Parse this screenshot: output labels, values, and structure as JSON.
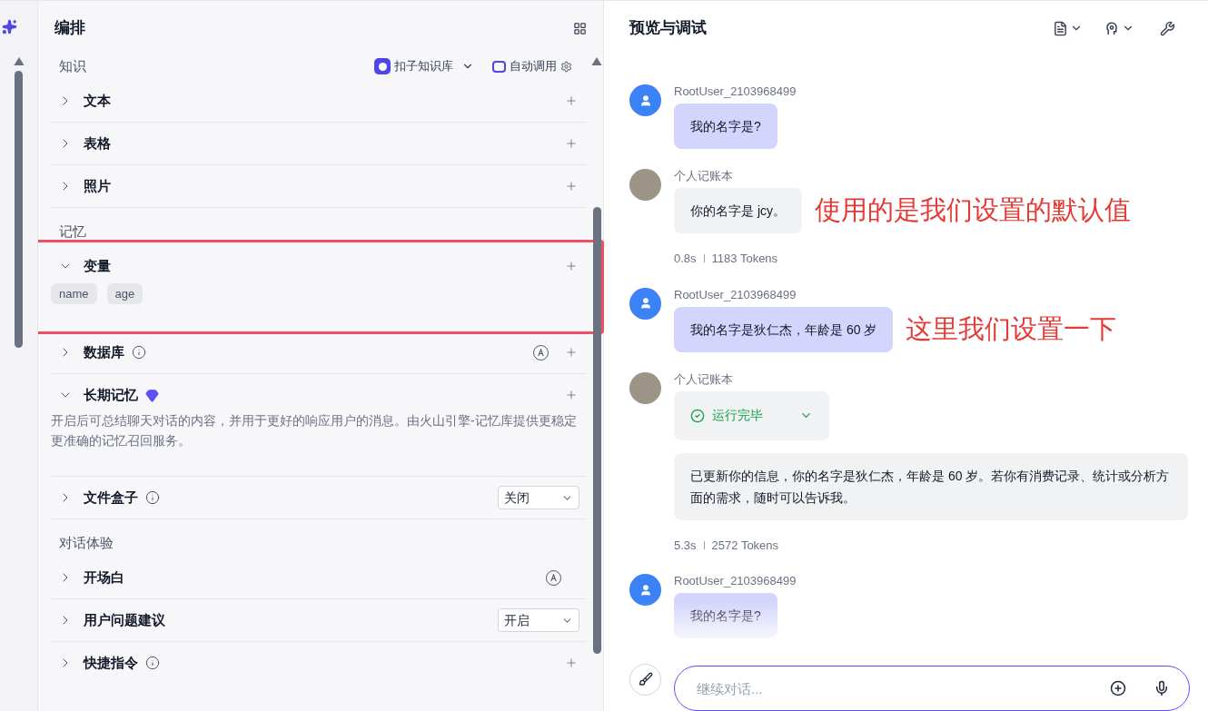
{
  "editor": {
    "title": "编排",
    "groups": [
      {
        "label": "知识",
        "source": "扣子知识库",
        "mode": "自动调用",
        "rows": [
          {
            "title": "文本",
            "expanded": false,
            "info": false,
            "auto": false,
            "kind": "plus"
          },
          {
            "title": "表格",
            "expanded": false,
            "info": false,
            "auto": false,
            "kind": "plus"
          },
          {
            "title": "照片",
            "expanded": false,
            "info": false,
            "auto": false,
            "kind": "plus"
          }
        ]
      },
      {
        "label": "记忆",
        "rows": [
          {
            "title": "变量",
            "expanded": true,
            "info": false,
            "auto": false,
            "kind": "plus",
            "highlighted": true,
            "tags": [
              "name",
              "age"
            ]
          },
          {
            "title": "数据库",
            "expanded": false,
            "info": true,
            "auto": true,
            "kind": "plus"
          },
          {
            "title": "长期记忆",
            "expanded": true,
            "info": false,
            "auto": false,
            "premium": true,
            "kind": "plus",
            "description": "开启后可总结聊天对话的内容，并用于更好的响应用户的消息。由火山引擎-记忆库提供更稳定更准确的记忆召回服务。"
          },
          {
            "title": "文件盒子",
            "expanded": false,
            "info": true,
            "auto": false,
            "kind": "select",
            "value": "关闭"
          }
        ]
      },
      {
        "label": "对话体验",
        "rows": [
          {
            "title": "开场白",
            "expanded": false,
            "info": false,
            "auto": true,
            "kind": "none"
          },
          {
            "title": "用户问题建议",
            "expanded": false,
            "info": false,
            "auto": false,
            "kind": "select",
            "value": "开启"
          },
          {
            "title": "快捷指令",
            "expanded": false,
            "info": true,
            "auto": false,
            "kind": "plus"
          }
        ]
      }
    ]
  },
  "preview": {
    "title": "预览与调试",
    "messages": [
      {
        "kind": "user",
        "name": "RootUser_2103968499",
        "text": "我的名字是?"
      },
      {
        "kind": "bot",
        "name": "个人记账本",
        "text": "你的名字是 jcy。",
        "time": "0.8s",
        "tokens": "1183 Tokens",
        "annotation": "使用的是我们设置的默认值"
      },
      {
        "kind": "user",
        "name": "RootUser_2103968499",
        "text": "我的名字是狄仁杰，年龄是 60 岁",
        "annotation": "这里我们设置一下"
      },
      {
        "kind": "bot",
        "name": "个人记账本",
        "status": "运行完毕",
        "text": "已更新你的信息，你的名字是狄仁杰，年龄是 60 岁。若你有消费记录、统计或分析方面的需求，随时可以告诉我。",
        "time": "5.3s",
        "tokens": "2572 Tokens"
      },
      {
        "kind": "user",
        "name": "RootUser_2103968499",
        "text": "我的名字是?"
      }
    ],
    "input": {
      "placeholder": "继续对话..."
    }
  }
}
